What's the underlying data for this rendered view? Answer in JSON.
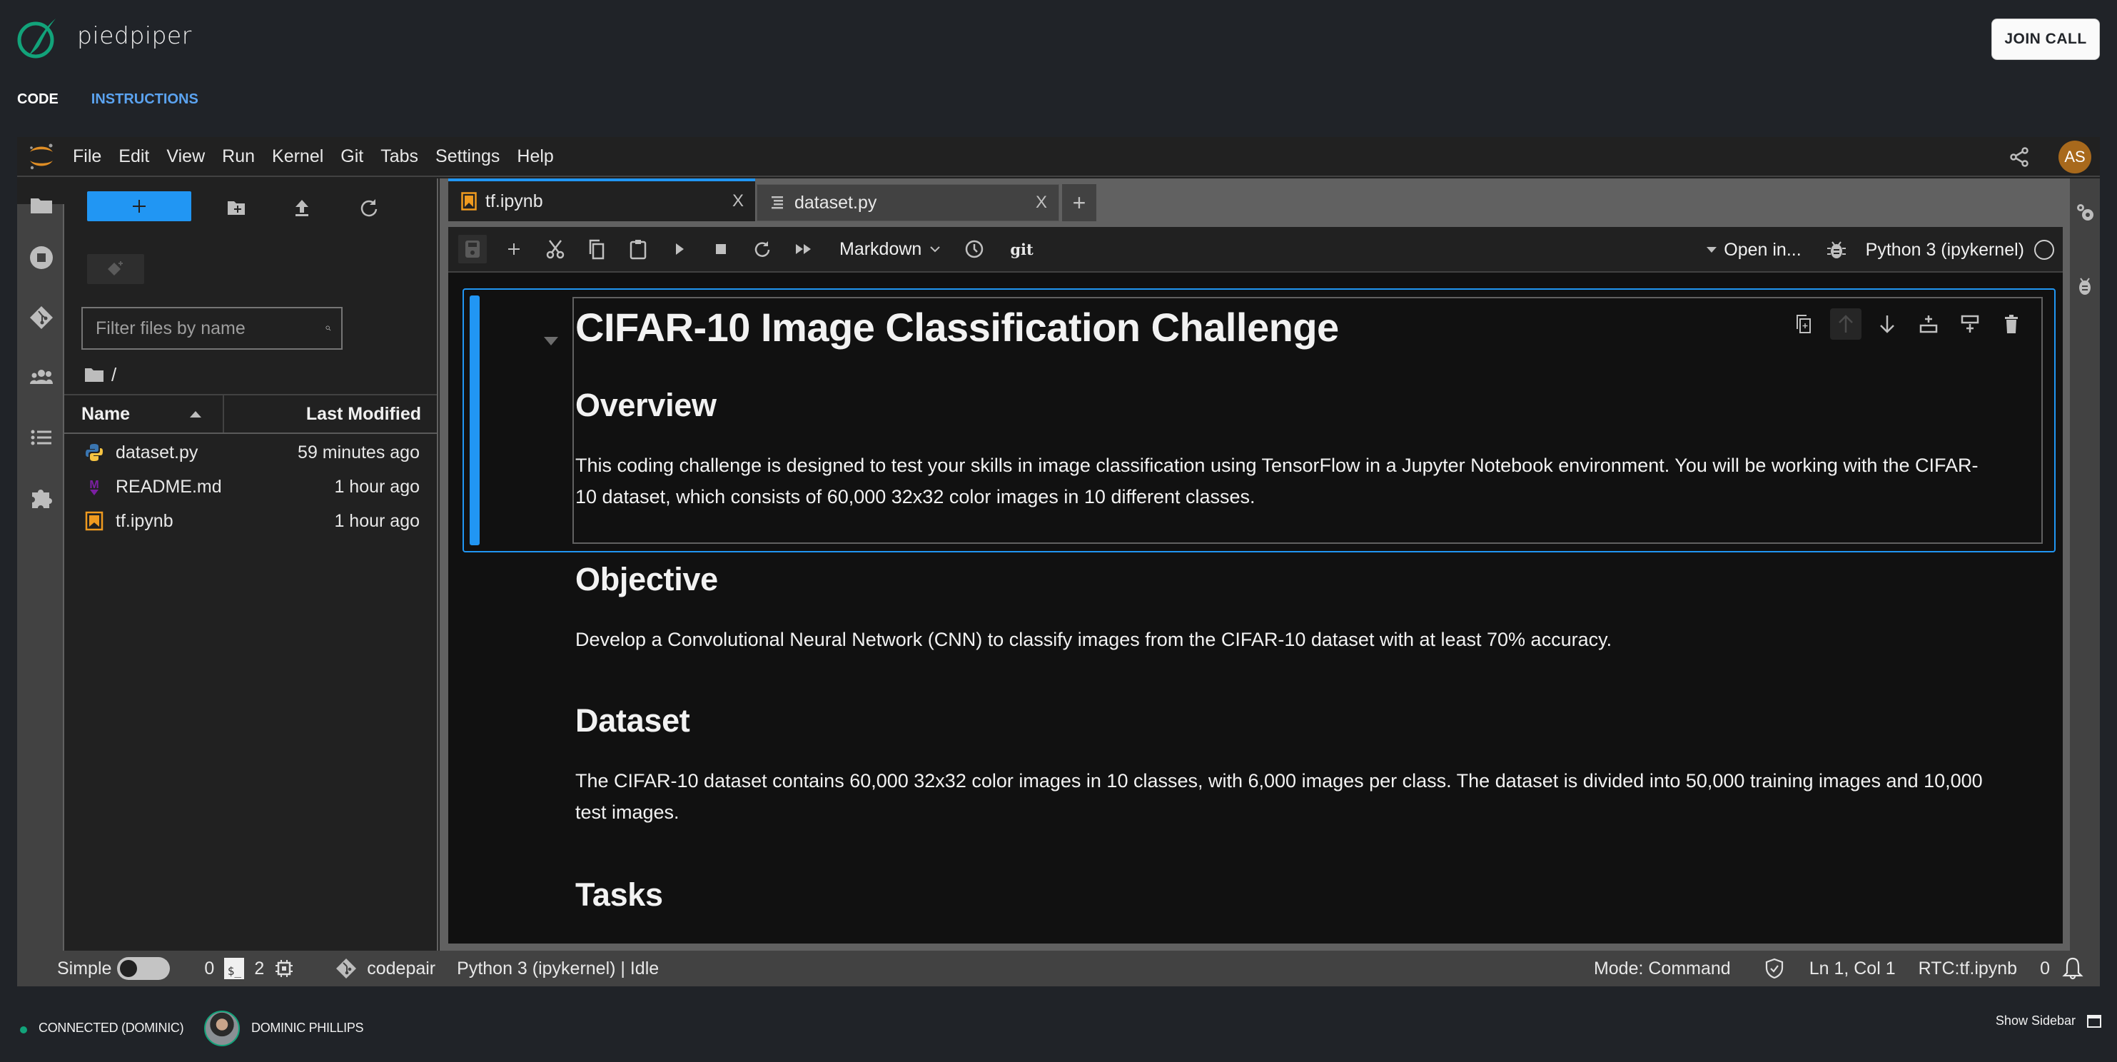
{
  "app": {
    "brand": "piedpiper",
    "join_call": "JOIN CALL",
    "tabs": [
      {
        "label": "CODE",
        "active": true
      },
      {
        "label": "INSTRUCTIONS",
        "active": false
      }
    ],
    "brand_color": "#12a37a",
    "link_color": "#5ba3f0"
  },
  "jupyter": {
    "menu": [
      "File",
      "Edit",
      "View",
      "Run",
      "Kernel",
      "Git",
      "Tabs",
      "Settings",
      "Help"
    ],
    "user_initials": "AS",
    "user_color": "#a8691c",
    "activity_bar": [
      "folder-icon",
      "running-icon",
      "git-icon",
      "collaborators-icon",
      "toc-icon",
      "extensions-icon"
    ],
    "file_browser": {
      "new_label": "+",
      "filter_placeholder": "Filter files by name",
      "filter_value": "",
      "path": "/",
      "columns": {
        "name": "Name",
        "modified": "Last Modified"
      },
      "files": [
        {
          "name": "dataset.py",
          "modified": "59 minutes ago",
          "type": "python"
        },
        {
          "name": "README.md",
          "modified": "1 hour ago",
          "type": "markdown"
        },
        {
          "name": "tf.ipynb",
          "modified": "1 hour ago",
          "type": "notebook"
        }
      ]
    },
    "doc_tabs": [
      {
        "label": "tf.ipynb",
        "active": true,
        "close": "X"
      },
      {
        "label": "dataset.py",
        "active": false,
        "close": "X"
      }
    ],
    "add_tab": "+",
    "toolbar": {
      "cell_type": "Markdown",
      "git": "git",
      "open_in": "Open in...",
      "kernel": "Python 3 (ipykernel)"
    },
    "notebook": {
      "title": "CIFAR-10 Image Classification Challenge",
      "sections": [
        {
          "heading": "Overview",
          "text": "This coding challenge is designed to test your skills in image classification using TensorFlow in a Jupyter Notebook environment. You will be working with the CIFAR-10 dataset, which consists of 60,000 32x32 color images in 10 different classes."
        },
        {
          "heading": "Objective",
          "text": "Develop a Convolutional Neural Network (CNN) to classify images from the CIFAR-10 dataset with at least 70% accuracy."
        },
        {
          "heading": "Dataset",
          "text": "The CIFAR-10 dataset contains 60,000 32x32 color images in 10 classes, with 6,000 images per class. The dataset is divided into 50,000 training images and 10,000 test images."
        },
        {
          "heading": "Tasks",
          "text": ""
        }
      ]
    },
    "statusbar": {
      "simple_label": "Simple",
      "simple_on": false,
      "terminals": "0",
      "kernels": "2",
      "branch": "codepair",
      "kernel_status": "Python 3 (ipykernel) | Idle",
      "mode": "Mode: Command",
      "position": "Ln 1, Col 1",
      "rtc": "RTC:tf.ipynb",
      "notifications": "0"
    }
  },
  "footer": {
    "connection": "CONNECTED (DOMINIC)",
    "user": "DOMINIC PHILLIPS",
    "show_sidebar": "Show Sidebar"
  }
}
